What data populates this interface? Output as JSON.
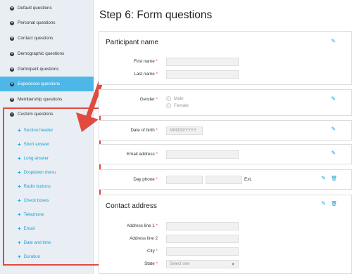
{
  "sidebar": {
    "items": [
      {
        "label": "Default questions"
      },
      {
        "label": "Personal questions"
      },
      {
        "label": "Contact questions"
      },
      {
        "label": "Demographic questions"
      },
      {
        "label": "Participant questions"
      },
      {
        "label": "Experience questions"
      },
      {
        "label": "Membership questions"
      },
      {
        "label": "Custom questions"
      }
    ],
    "active_index": 5,
    "custom_items": [
      {
        "label": "Section header"
      },
      {
        "label": "Short answer"
      },
      {
        "label": "Long answer"
      },
      {
        "label": "Dropdown menu"
      },
      {
        "label": "Radio buttons"
      },
      {
        "label": "Check boxes"
      },
      {
        "label": "Telephone"
      },
      {
        "label": "Email"
      },
      {
        "label": "Date and time"
      },
      {
        "label": "Duration"
      }
    ]
  },
  "page_title": "Step 6: Form questions",
  "participant": {
    "heading": "Participant name",
    "first_name": "First name",
    "last_name": "Last name"
  },
  "gender": {
    "label": "Gender",
    "options": [
      "Male",
      "Female"
    ]
  },
  "dob": {
    "label": "Date of birth",
    "placeholder": "MM/DD/YYYY"
  },
  "email": {
    "label": "Email address"
  },
  "phone": {
    "label": "Day phone",
    "ext": "Ext."
  },
  "contact": {
    "heading": "Contact address",
    "line1": "Address line 1",
    "line2": "Address line 2",
    "city": "City",
    "state": "State",
    "state_placeholder": "Select one"
  },
  "required_mark": "*",
  "colors": {
    "accent": "#1aa0d8",
    "active": "#4db8e8",
    "highlight": "#e04a3f"
  }
}
